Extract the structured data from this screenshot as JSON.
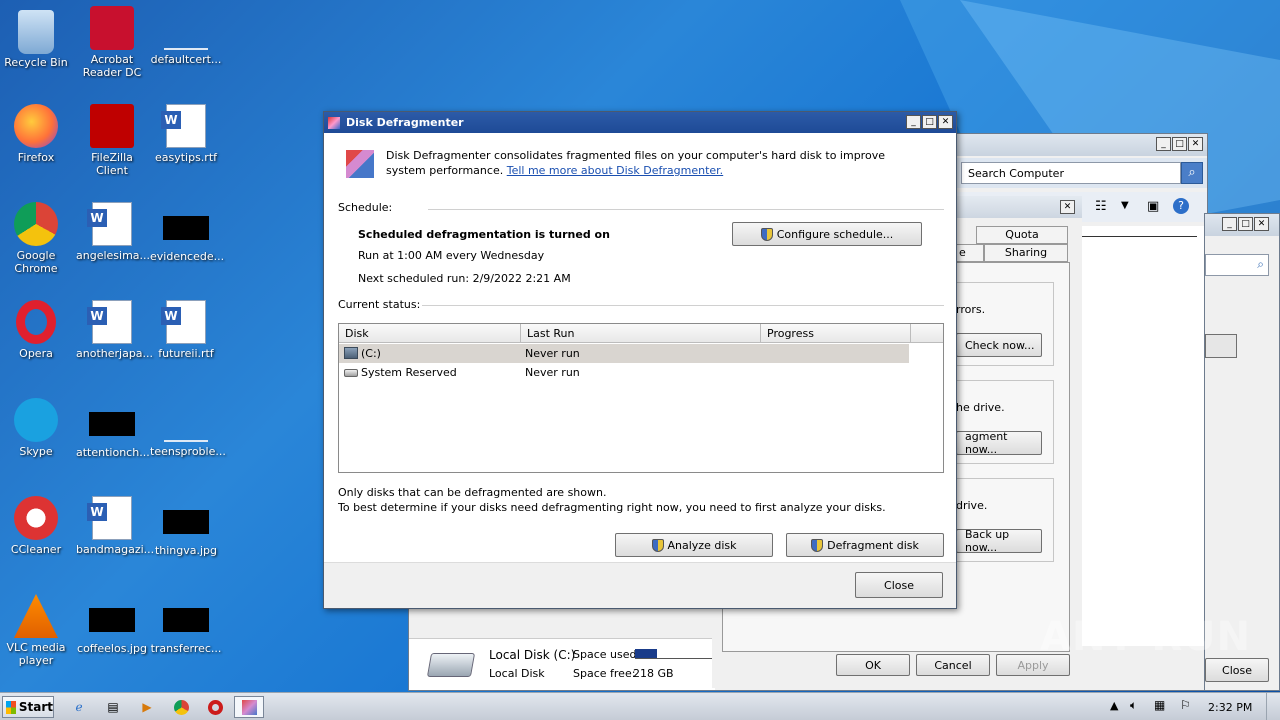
{
  "desktop": {
    "icons": [
      {
        "label": "Recycle Bin",
        "icon": "recycle-bin-icon"
      },
      {
        "label": "Acrobat Reader DC",
        "icon": "acrobat-icon"
      },
      {
        "label": "defaultcert...",
        "icon": "file-icon"
      },
      {
        "label": "Firefox",
        "icon": "firefox-icon"
      },
      {
        "label": "FileZilla Client",
        "icon": "filezilla-icon"
      },
      {
        "label": "easytips.rtf",
        "icon": "word-doc-icon"
      },
      {
        "label": "Google Chrome",
        "icon": "chrome-icon"
      },
      {
        "label": "angelesima...",
        "icon": "word-doc-icon"
      },
      {
        "label": "evidencede...",
        "icon": "black-thumbnail-icon"
      },
      {
        "label": "Opera",
        "icon": "opera-icon"
      },
      {
        "label": "anotherjapa...",
        "icon": "word-doc-icon"
      },
      {
        "label": "futureii.rtf",
        "icon": "word-doc-icon"
      },
      {
        "label": "Skype",
        "icon": "skype-icon"
      },
      {
        "label": "attentionch...",
        "icon": "black-thumbnail-icon"
      },
      {
        "label": "teensproble...",
        "icon": "file-icon"
      },
      {
        "label": "CCleaner",
        "icon": "ccleaner-icon"
      },
      {
        "label": "bandmagazi...",
        "icon": "word-doc-icon"
      },
      {
        "label": "thingva.jpg",
        "icon": "black-thumbnail-icon"
      },
      {
        "label": "VLC media player",
        "icon": "vlc-icon"
      },
      {
        "label": "coffeelos.jpg",
        "icon": "black-thumbnail-icon"
      },
      {
        "label": "transferrec...",
        "icon": "black-thumbnail-icon"
      }
    ]
  },
  "explorer": {
    "search_placeholder": "Search Computer",
    "drive": {
      "name": "Local Disk (C:)",
      "type": "Local Disk",
      "space_used_label": "Space used:",
      "space_free_label": "Space free:",
      "space_free_value": "218 GB",
      "used_fraction": 0.28
    }
  },
  "properties": {
    "tabs_row1": [
      "Quota"
    ],
    "tabs_row2": [
      "e",
      "Sharing"
    ],
    "sections": [
      {
        "text": "rrors.",
        "button": "Check now..."
      },
      {
        "text": "he drive.",
        "button": "agment now..."
      },
      {
        "text": "drive.",
        "button": "Back up now..."
      }
    ],
    "ok": "OK",
    "cancel": "Cancel",
    "apply": "Apply"
  },
  "back_window": {
    "close_label": "Close"
  },
  "defrag": {
    "title": "Disk Defragmenter",
    "intro": "Disk Defragmenter consolidates fragmented files on your computer's hard disk to improve system performance.",
    "link": "Tell me more about Disk Defragmenter.",
    "schedule_label": "Schedule:",
    "schedule_status": "Scheduled defragmentation is turned on",
    "run_at": "Run at 1:00 AM every Wednesday",
    "next_run": "Next scheduled run: 2/9/2022 2:21 AM",
    "configure_button": "Configure schedule...",
    "current_status_label": "Current status:",
    "columns": [
      "Disk",
      "Last Run",
      "Progress"
    ],
    "rows": [
      {
        "disk": "(C:)",
        "last_run": "Never run",
        "progress": ""
      },
      {
        "disk": "System Reserved",
        "last_run": "Never run",
        "progress": ""
      }
    ],
    "note1": "Only disks that can be defragmented are shown.",
    "note2": "To best determine if your disks need defragmenting right now, you need to first analyze your disks.",
    "analyze_button": "Analyze disk",
    "defrag_button": "Defragment disk",
    "close_button": "Close"
  },
  "taskbar": {
    "start_label": "Start",
    "clock": "2:32 PM"
  },
  "watermark": "ANY RUN"
}
